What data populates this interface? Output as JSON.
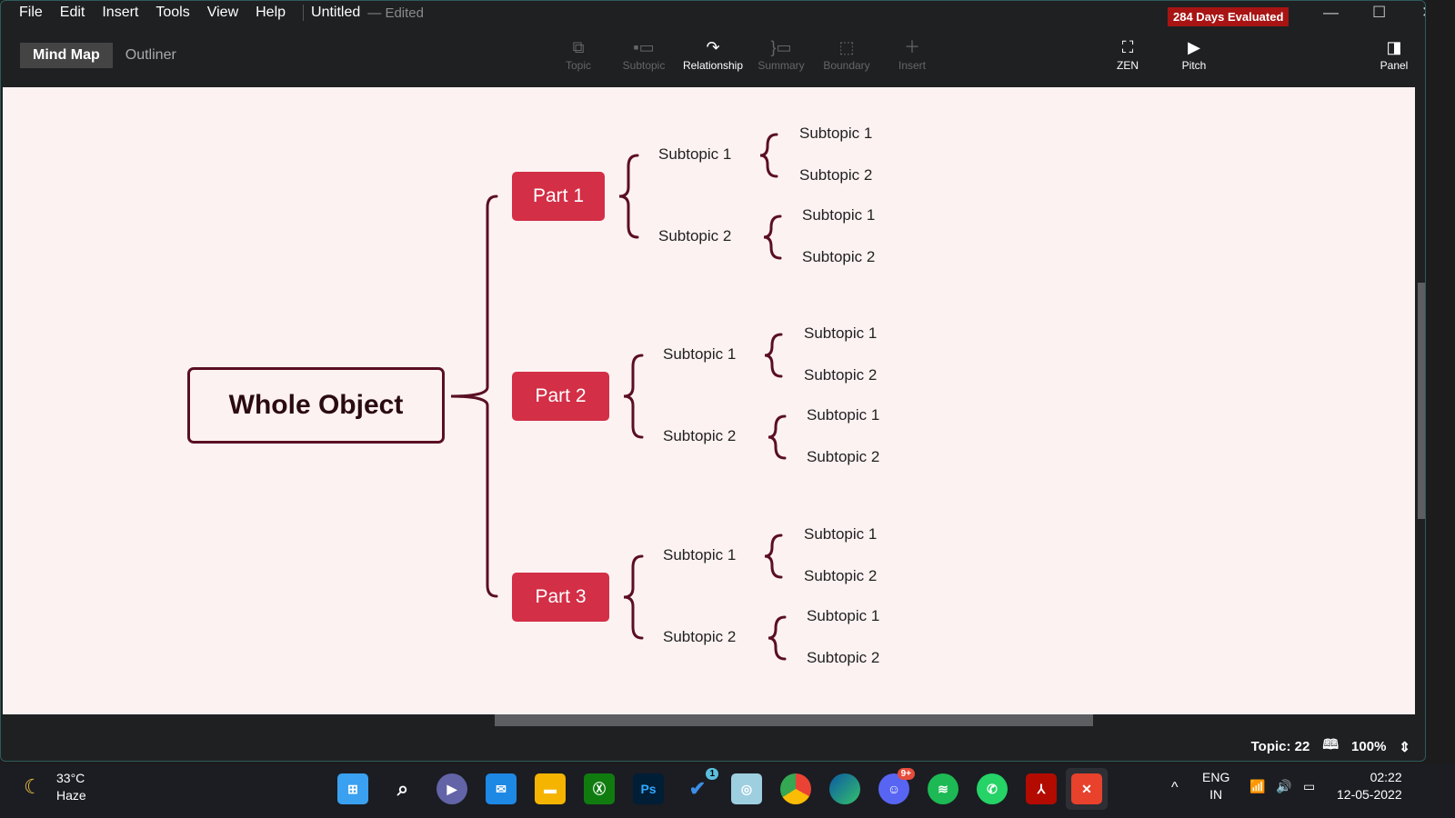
{
  "menu": [
    "File",
    "Edit",
    "Insert",
    "Tools",
    "View",
    "Help"
  ],
  "doc_title": "Untitled",
  "doc_status": "— Edited",
  "eval_badge": "284 Days Evaluated",
  "modes": [
    "Mind Map",
    "Outliner"
  ],
  "tools": [
    {
      "label": "Topic",
      "icon": "topic-icon"
    },
    {
      "label": "Subtopic",
      "icon": "subtopic-icon"
    },
    {
      "label": "Relationship",
      "icon": "relationship-icon"
    },
    {
      "label": "Summary",
      "icon": "summary-icon"
    },
    {
      "label": "Boundary",
      "icon": "boundary-icon"
    },
    {
      "label": "Insert",
      "icon": "plus-icon"
    }
  ],
  "right_tools": [
    {
      "label": "ZEN",
      "icon": "fullscreen-icon"
    },
    {
      "label": "Pitch",
      "icon": "play-icon"
    },
    {
      "label": "Panel",
      "icon": "panel-icon"
    }
  ],
  "colors": {
    "topic": "#d32f47",
    "line": "#5a0f22",
    "canvas": "#fdf2f2"
  },
  "mindmap": {
    "root": "Whole Object",
    "parts": [
      {
        "label": "Part 1",
        "children": [
          {
            "label": "Subtopic 1",
            "children": [
              "Subtopic 1",
              "Subtopic 2"
            ]
          },
          {
            "label": "Subtopic 2",
            "children": [
              "Subtopic 1",
              "Subtopic 2"
            ]
          }
        ]
      },
      {
        "label": "Part 2",
        "children": [
          {
            "label": "Subtopic 1",
            "children": [
              "Subtopic 1",
              "Subtopic 2"
            ]
          },
          {
            "label": "Subtopic 2",
            "children": [
              "Subtopic 1",
              "Subtopic 2"
            ]
          }
        ]
      },
      {
        "label": "Part 3",
        "children": [
          {
            "label": "Subtopic 1",
            "children": [
              "Subtopic 1",
              "Subtopic 2"
            ]
          },
          {
            "label": "Subtopic 2",
            "children": [
              "Subtopic 1",
              "Subtopic 2"
            ]
          }
        ]
      }
    ]
  },
  "status": {
    "topic_count": "Topic: 22",
    "zoom": "100%"
  },
  "taskbar": {
    "weather_temp": "33°C",
    "weather_desc": "Haze",
    "lang": "ENG",
    "region": "IN",
    "time": "02:22",
    "date": "12-05-2022",
    "badges": {
      "todo": "1",
      "discord": "9+"
    },
    "ps_label": "Ps"
  }
}
